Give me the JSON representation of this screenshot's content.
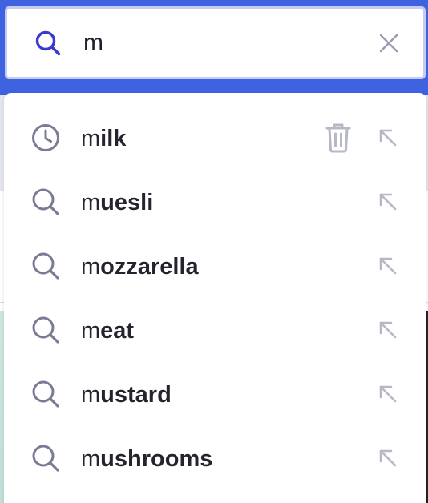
{
  "search": {
    "value": "m",
    "clear_icon": "close-icon",
    "search_icon": "search-icon"
  },
  "suggestions": [
    {
      "typed": "m",
      "rest": "ilk",
      "type": "history",
      "icon": "clock-icon",
      "deletable": true
    },
    {
      "typed": "m",
      "rest": "uesli",
      "type": "suggestion",
      "icon": "search-icon",
      "deletable": false
    },
    {
      "typed": "m",
      "rest": "ozzarella",
      "type": "suggestion",
      "icon": "search-icon",
      "deletable": false
    },
    {
      "typed": "m",
      "rest": "eat",
      "type": "suggestion",
      "icon": "search-icon",
      "deletable": false
    },
    {
      "typed": "m",
      "rest": "ustard",
      "type": "suggestion",
      "icon": "search-icon",
      "deletable": false
    },
    {
      "typed": "m",
      "rest": "ushrooms",
      "type": "suggestion",
      "icon": "search-icon",
      "deletable": false
    }
  ],
  "colors": {
    "accent": "#3a3ad0",
    "input_border": "#c5cbf3",
    "header_bg": "#3f63e0",
    "icon_grey": "#7a7b96",
    "icon_light": "#b6b8c6",
    "text": "#24242e"
  }
}
